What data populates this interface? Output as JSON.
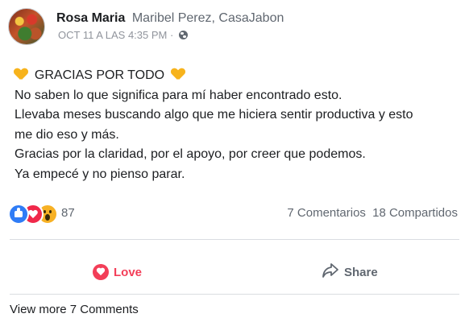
{
  "post": {
    "author": "Rosa Maria",
    "group": "Maribel Perez, CasaJabon",
    "timestamp": "OCT 11 A LAS 4:35 PM",
    "separator": "·",
    "privacy_icon": "globe-icon",
    "heading": "GRACIAS POR TODO",
    "lines": [
      "No saben lo que significa para mí haber encontrado esto.",
      "Llevaba meses buscando algo que me hiciera sentir productiva y esto",
      "me dio eso y más.",
      "Gracias por la claridad, por el apoyo, por creer que podemos.",
      "Ya empecé y no pienso parar."
    ],
    "heart_color": "#f7b31c"
  },
  "reactions": {
    "icons": [
      "like-icon",
      "love-icon",
      "wow-icon"
    ],
    "count": "87",
    "comments": "7 Comentarios",
    "shares": "18 Compartidos"
  },
  "actions": {
    "love_label": "Love",
    "share_label": "Share",
    "love_color": "#f33e58"
  },
  "comments": {
    "view_more": "View more 7 Comments"
  }
}
